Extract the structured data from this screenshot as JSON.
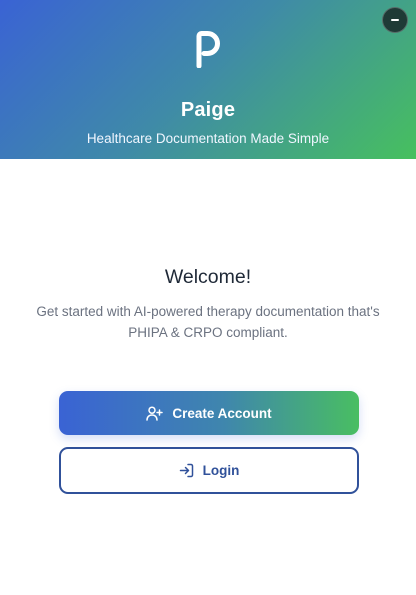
{
  "header": {
    "logo_icon": "paige-p-logo-icon",
    "app_name": "Paige",
    "tagline": "Healthcare Documentation Made Simple",
    "minimize_icon": "minus-icon",
    "colors": {
      "gradient_start": "#3a63d4",
      "gradient_end": "#47c05e"
    }
  },
  "welcome": {
    "title": "Welcome!",
    "description": "Get started with AI-powered therapy documentation that's PHIPA & CRPO compliant."
  },
  "actions": {
    "create_account": {
      "label": "Create Account",
      "icon": "user-plus-icon"
    },
    "login": {
      "label": "Login",
      "icon": "login-icon",
      "color": "#30519a"
    }
  }
}
